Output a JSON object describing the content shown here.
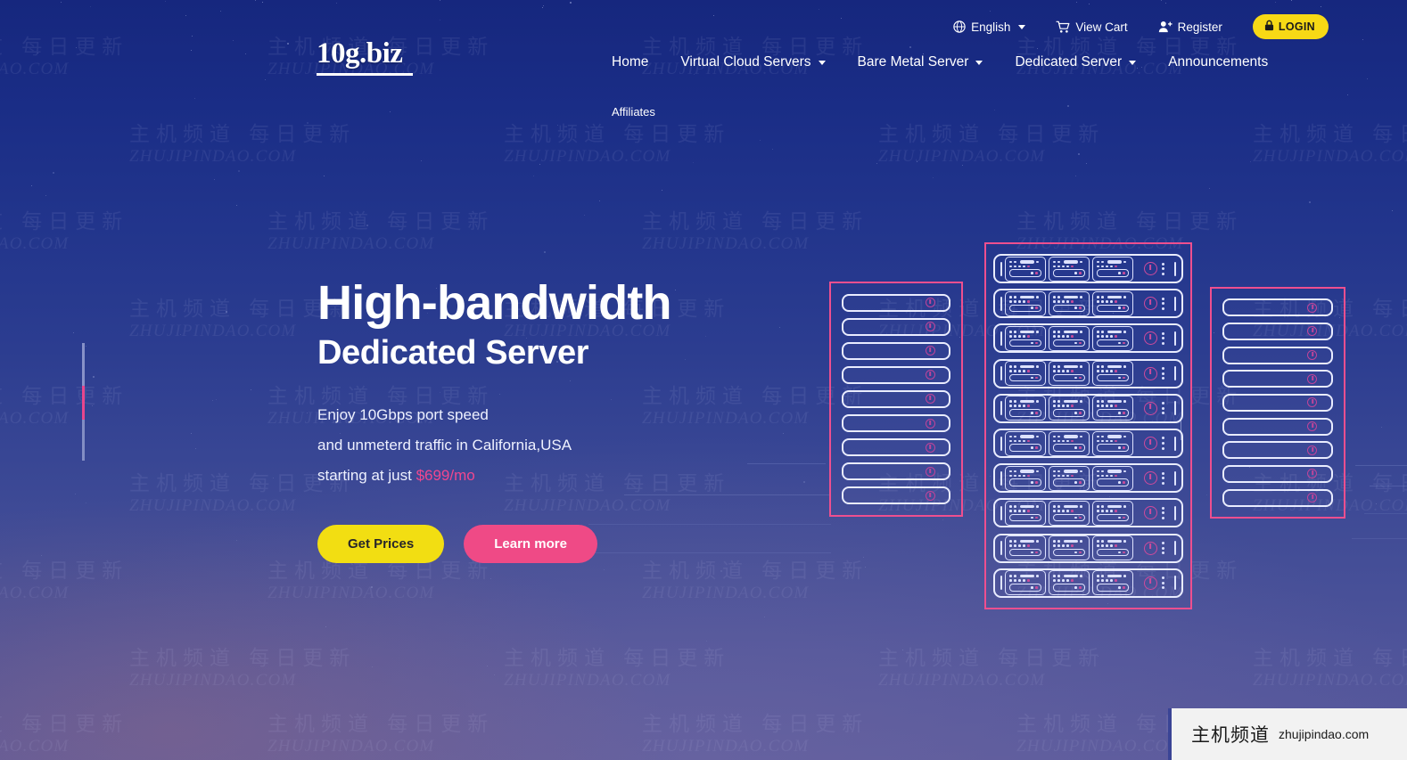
{
  "site": {
    "logo_text": "10g.biz"
  },
  "topbar": {
    "language": "English",
    "language_icon": "globe-icon",
    "cart": "View Cart",
    "cart_icon": "shopping-cart-icon",
    "register": "Register",
    "register_icon": "user-plus-icon",
    "login": "LOGIN",
    "login_icon": "lock-icon",
    "login_bg": "#f7d915"
  },
  "nav": {
    "items": [
      {
        "label": "Home",
        "has_dropdown": false
      },
      {
        "label": "Virtual Cloud Servers",
        "has_dropdown": true
      },
      {
        "label": "Bare Metal Server",
        "has_dropdown": true
      },
      {
        "label": "Dedicated Server",
        "has_dropdown": true
      },
      {
        "label": "Announcements",
        "has_dropdown": false
      }
    ],
    "secondary": [
      {
        "label": "Affiliates",
        "has_dropdown": false
      }
    ]
  },
  "hero": {
    "title_line1": "High-bandwidth",
    "title_line2": "Dedicated Server",
    "desc_line1": "Enjoy 10Gbps port speed",
    "desc_line2": "and unmeterd traffic in California,USA",
    "desc_line3_prefix": "starting at just ",
    "price": "$699/mo",
    "price_color": "#f0478f",
    "cta_primary": "Get Prices",
    "cta_secondary": "Learn more",
    "cta_primary_bg": "#f2de12",
    "cta_secondary_bg": "#ef4a86"
  },
  "illustration": {
    "name": "server-rack-illustration",
    "rack_border_color": "#ee4f8f",
    "unit_color": "#e9ecff",
    "racks": [
      {
        "name": "left-rack",
        "units": 9,
        "detailed": false
      },
      {
        "name": "center-rack",
        "units": 10,
        "detailed": true
      },
      {
        "name": "right-rack",
        "units": 9,
        "detailed": false
      }
    ]
  },
  "watermark": {
    "cn": "主机频道 每日更新",
    "en": "ZHUJIPINDAO.COM"
  },
  "badge": {
    "cn": "主机频道",
    "en": "zhujipindao.com"
  }
}
